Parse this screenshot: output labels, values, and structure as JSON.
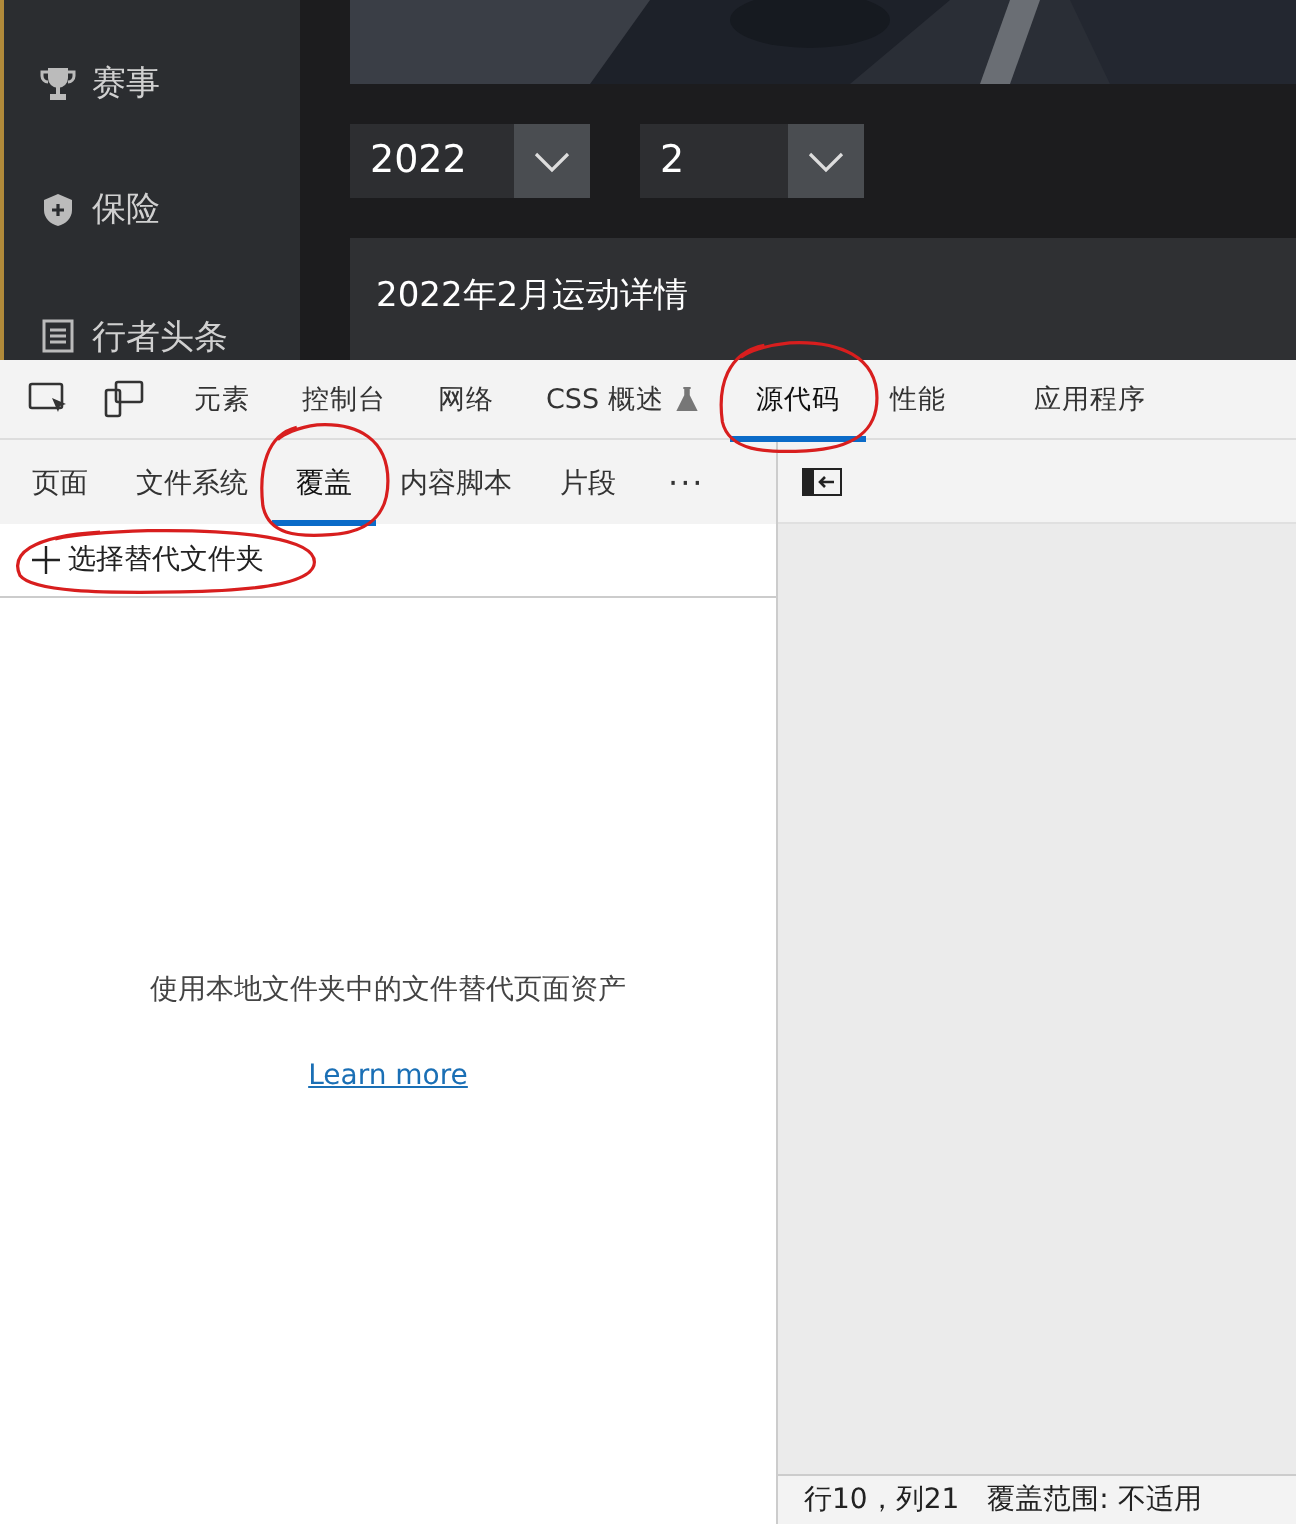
{
  "app": {
    "sidebar": [
      {
        "kind": "trophy",
        "label": "赛事"
      },
      {
        "kind": "shield",
        "label": "保险"
      },
      {
        "kind": "list",
        "label": "行者头条"
      }
    ],
    "selects": [
      {
        "value": "2022"
      },
      {
        "value": "2"
      }
    ],
    "card_title": "2022年2月运动详情"
  },
  "devtools": {
    "tabs": [
      {
        "label": "元素",
        "selected": false,
        "circled": false
      },
      {
        "label": "控制台",
        "selected": false,
        "circled": false
      },
      {
        "label": "网络",
        "selected": false,
        "circled": false
      },
      {
        "label": "CSS 概述",
        "selected": false,
        "circled": false,
        "flask": true
      },
      {
        "label": "源代码",
        "selected": true,
        "circled": true
      },
      {
        "label": "性能",
        "selected": false,
        "circled": false
      },
      {
        "label": "应用程序",
        "selected": false,
        "circled": false
      }
    ],
    "sub_tabs": [
      {
        "label": "页面",
        "selected": false,
        "circled": false
      },
      {
        "label": "文件系统",
        "selected": false,
        "circled": false
      },
      {
        "label": "覆盖",
        "selected": true,
        "circled": true
      },
      {
        "label": "内容脚本",
        "selected": false,
        "circled": false
      },
      {
        "label": "片段",
        "selected": false,
        "circled": false
      }
    ],
    "more": "···",
    "add_button": {
      "label": "选择替代文件夹",
      "circled": true
    },
    "empty_message": "使用本地文件夹中的文件替代页面资产",
    "link": "Learn more",
    "status": [
      "行10，列21",
      "覆盖范围: 不适用"
    ]
  }
}
